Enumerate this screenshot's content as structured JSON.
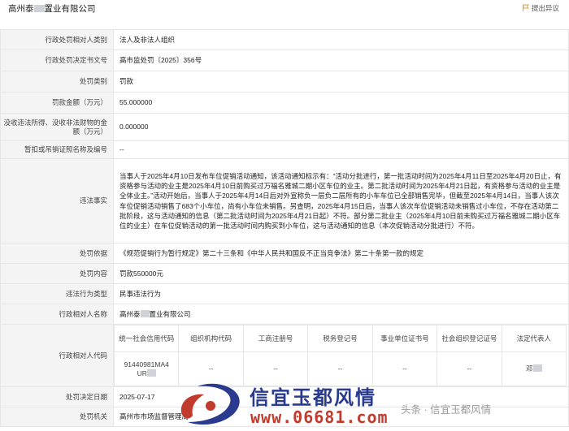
{
  "header": {
    "company_prefix": "高州泰",
    "company_suffix": "置业有限公司",
    "objection_label": "提出异议",
    "objection_icon": "flag-icon"
  },
  "rows": {
    "party_type": {
      "label": "行政处罚相对人类别",
      "value": "法人及非法人组织"
    },
    "decision_no": {
      "label": "行政处罚决定书文号",
      "value": "高市监处罚〔2025〕356号"
    },
    "penalty_type": {
      "label": "处罚类别",
      "value": "罚款"
    },
    "fine_amount": {
      "label": "罚款金额（万元）",
      "value": "55.000000"
    },
    "confiscation": {
      "label": "没收违法所得、没收非法财物的金额（万元）",
      "value": "0.000000"
    },
    "license_no": {
      "label": "暂扣或吊销证照名称及编号",
      "value": "--"
    },
    "facts": {
      "label": "违法事实",
      "value": "当事人于2025年4月10日发布车位促销活动通知，该活动通知标示有：“活动分批进行，第一批活动时间为2025年4月11日至2025年4月20日止，有资格参与活动的业主是2025年4月10日前购买过万福名雅城二期小区车位的业主。第二批活动时间为2025年4月21日起，有资格参与活动的业主是全体业主。”活动开始后，当事人于2025年4月14日后对外宣称负一层负二层所有的小车车位已全部销售完毕，但截至2025年4月14日，当事人该次车位促销活动销售了683个小车位，尚有小车位未销售。另查明，2025年4月15日后，当事人该次车位促销活动未销售过小车位，不存在活动第二批阶段，这与活动通知的信息（第二批活动时间为2025年4月21日起）不符。部分第二批业主（2025年4月10日前未购买过万福名雅城二期小区车位的业主）在车位促销活动的第一批活动时间内购买到小车位，这与活动通知的信息（本次促销活动分批进行）不符。"
    },
    "basis": {
      "label": "处罚依据",
      "value": "《规范促销行为暂行规定》第二十三条和《中华人民共和国反不正当竞争法》第二十条第一款的规定"
    },
    "content": {
      "label": "处罚内容",
      "value": "罚款550000元"
    },
    "violation_type": {
      "label": "违法行为类型",
      "value": "民事违法行为"
    },
    "party_name": {
      "label": "行政相对人名称",
      "value_prefix": "高州泰",
      "value_suffix": "置业有限公司"
    },
    "party_code": {
      "label": "行政相对人代码"
    },
    "decision_date": {
      "label": "处罚决定日期",
      "value": "2025-07-17"
    },
    "authority": {
      "label": "处罚机关",
      "value": "高州市市场监督管理局"
    }
  },
  "code_table": {
    "headers": [
      "统一社会信用代码",
      "组织机构代码",
      "工商注册号",
      "税务登记号",
      "事业单位证书号",
      "社会组织登记证号",
      "法定代表人"
    ],
    "credit_code_line1": "91440981MA4",
    "credit_code_line2": "UR",
    "values": [
      "--",
      "--",
      "--",
      "--",
      "--"
    ],
    "legal_rep": "邓"
  },
  "watermark": {
    "brand": "信宜玉都风情",
    "url": "www.06681.com",
    "gray_text": "头条 · 信宜玉都风情"
  }
}
